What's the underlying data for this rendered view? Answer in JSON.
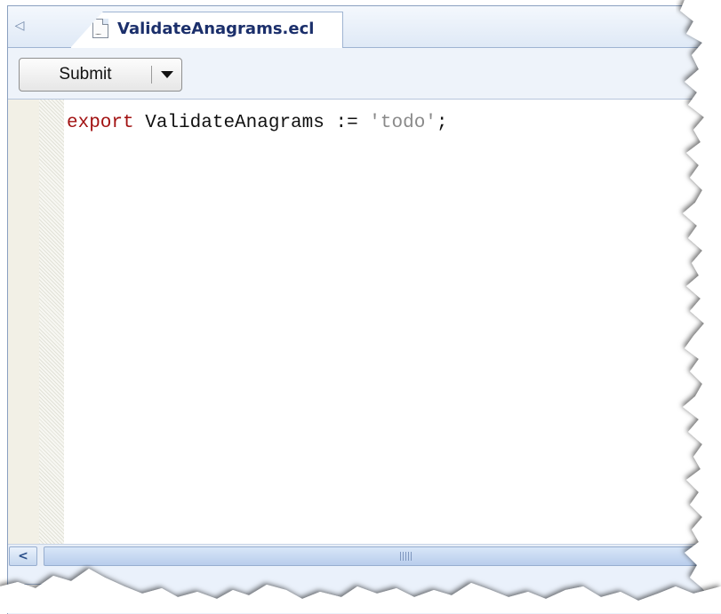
{
  "tabs": {
    "scroll_left_glyph": "◁",
    "active_tab": {
      "title": "ValidateAnagrams.ecl",
      "icon": "ecl-file-icon"
    }
  },
  "toolbar": {
    "submit_label": "Submit",
    "dropdown_icon": "chevron-down-icon"
  },
  "editor": {
    "code": {
      "keyword": "export",
      "identifier": " ValidateAnagrams := ",
      "string": "'todo'",
      "terminator": ";"
    },
    "colors": {
      "keyword": "#a21212",
      "string": "#8a8a8a"
    }
  },
  "scrollbar": {
    "left_arrow_glyph": "<"
  }
}
